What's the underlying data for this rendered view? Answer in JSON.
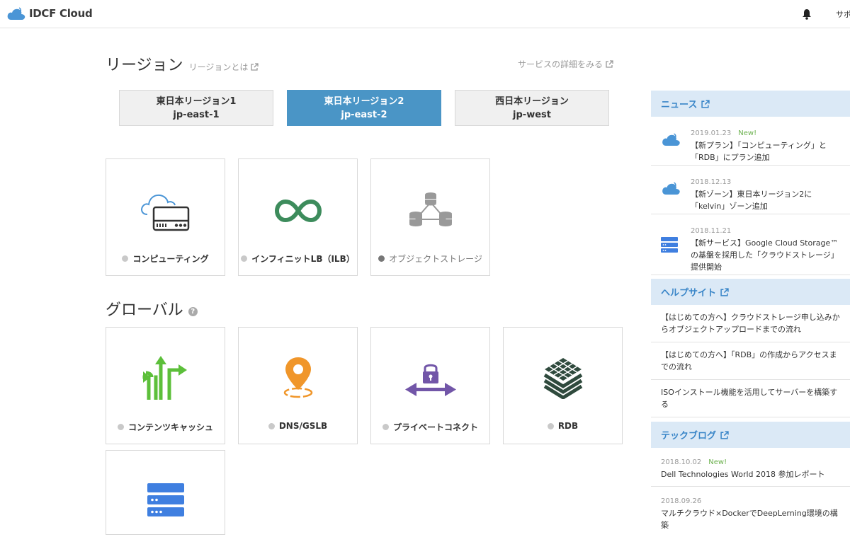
{
  "header": {
    "app_title": "IDCF Cloud",
    "support_label": "サポ"
  },
  "region": {
    "title": "リージョン",
    "about_link": "リージョンとは",
    "detail_link": "サービスの詳細をみる",
    "tabs": [
      {
        "name": "東日本リージョン1",
        "code": "jp-east-1",
        "active": false
      },
      {
        "name": "東日本リージョン2",
        "code": "jp-east-2",
        "active": true
      },
      {
        "name": "西日本リージョン",
        "code": "jp-west",
        "active": false
      }
    ],
    "services": [
      {
        "label": "コンピューティング",
        "icon": "cloud-server-icon"
      },
      {
        "label": "インフィニットLB（ILB）",
        "icon": "infinity-icon"
      },
      {
        "label": "オブジェクトストレージ",
        "icon": "object-storage-icon"
      }
    ]
  },
  "global": {
    "title": "グローバル",
    "help_icon": "?",
    "services": [
      {
        "label": "コンテンツキャッシュ",
        "icon": "cache-arrows-icon"
      },
      {
        "label": "DNS/GSLB",
        "icon": "location-pin-icon"
      },
      {
        "label": "プライベートコネクト",
        "icon": "private-connect-icon"
      },
      {
        "label": "RDB",
        "icon": "rdb-layers-icon"
      },
      {
        "label": "",
        "icon": "storage-server-icon"
      }
    ]
  },
  "sidebar": {
    "news": {
      "heading": "ニュース",
      "items": [
        {
          "date": "2019.01.23",
          "new_label": "New!",
          "text": "【新プラン】「コンピューティング」と「RDB」にプラン追加",
          "icon": "cloud-icon"
        },
        {
          "date": "2018.12.13",
          "new_label": "",
          "text": "【新ゾーン】東日本リージョン2に「kelvin」ゾーン追加",
          "icon": "cloud-icon"
        },
        {
          "date": "2018.11.21",
          "new_label": "",
          "text": "【新サービス】Google Cloud Storage™の基盤を採用した「クラウドストレージ」提供開始",
          "icon": "storage-icon"
        }
      ]
    },
    "help": {
      "heading": "ヘルプサイト",
      "items": [
        "【はじめての方へ】クラウドストレージ申し込みからオブジェクトアップロードまでの流れ",
        "【はじめての方へ】「RDB」の作成からアクセスまでの流れ",
        "ISOインストール機能を活用してサーバーを構築する"
      ]
    },
    "blog": {
      "heading": "テックブログ",
      "items": [
        {
          "date": "2018.10.02",
          "new_label": "New!",
          "text": "Dell Technologies World 2018 参加レポート"
        },
        {
          "date": "2018.09.26",
          "new_label": "",
          "text": "マルチクラウド×DockerでDeepLerning環境の構築"
        }
      ]
    }
  },
  "colors": {
    "accent": "#4a95c6",
    "sidebar_head_bg": "#dbe9f6",
    "sidebar_head_text": "#3a86c8",
    "new_badge": "#6ab04c"
  }
}
